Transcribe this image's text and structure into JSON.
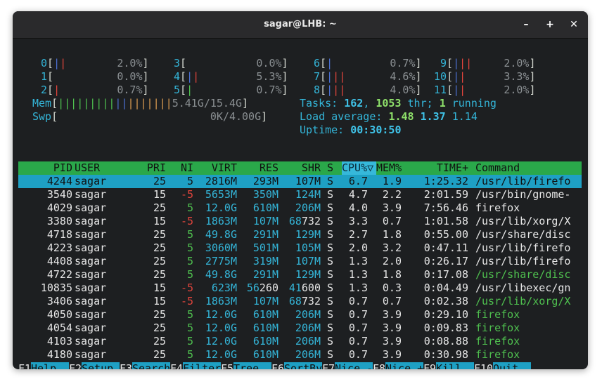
{
  "window": {
    "title": "sagar@LHB: ~",
    "minimize": "–",
    "maximize": "+",
    "close": "✕"
  },
  "cpus": [
    {
      "id": "0",
      "value": "2.0%"
    },
    {
      "id": "1",
      "value": "0.0%"
    },
    {
      "id": "2",
      "value": "0.7%"
    },
    {
      "id": "3",
      "value": "0.0%"
    },
    {
      "id": "4",
      "value": "5.3%"
    },
    {
      "id": "5",
      "value": "0.7%"
    },
    {
      "id": "6",
      "value": "0.7%"
    },
    {
      "id": "7",
      "value": "4.6%"
    },
    {
      "id": "8",
      "value": "4.0%"
    },
    {
      "id": "9",
      "value": "2.0%"
    },
    {
      "id": "10",
      "value": "3.3%"
    },
    {
      "id": "11",
      "value": "2.0%"
    }
  ],
  "mem": {
    "label": "Mem",
    "value": "5.41G/15.4G"
  },
  "swp": {
    "label": "Swp",
    "value": "0K/4.00G"
  },
  "tasks": {
    "label": "Tasks: ",
    "count": "162",
    "thr": "1053",
    "thr_label": " thr; ",
    "running": "1",
    "running_label": " running"
  },
  "load": {
    "label": "Load average: ",
    "v1": "1.48",
    "v2": "1.37",
    "v3": "1.14"
  },
  "uptime": {
    "label": "Uptime: ",
    "value": "00:30:50"
  },
  "columns": [
    "PID",
    "USER",
    "PRI",
    "NI",
    "VIRT",
    "RES",
    "SHR",
    "S",
    "CPU%▽",
    "MEM%",
    "TIME+",
    "Command"
  ],
  "processes": [
    {
      "pid": "4244",
      "user": "sagar",
      "pri": "25",
      "ni": "5",
      "virt": "2816M",
      "res": "293M",
      "shr": "107M",
      "s": "S",
      "cpu": "6.7",
      "mem": "1.9",
      "time": "1:25.32",
      "cmd": "/usr/lib/firefo"
    },
    {
      "pid": "3540",
      "user": "sagar",
      "pri": "15",
      "ni": "-5",
      "virt": "5653M",
      "res": "350M",
      "shr": "124M",
      "s": "S",
      "cpu": "4.7",
      "mem": "2.2",
      "time": "2:01.59",
      "cmd": "/usr/bin/gnome-"
    },
    {
      "pid": "4029",
      "user": "sagar",
      "pri": "25",
      "ni": "5",
      "virt": "12.0G",
      "res": "610M",
      "shr": "206M",
      "s": "S",
      "cpu": "4.0",
      "mem": "3.9",
      "time": "7:56.46",
      "cmd": "firefox"
    },
    {
      "pid": "3380",
      "user": "sagar",
      "pri": "15",
      "ni": "-5",
      "virt": "1863M",
      "res": "107M",
      "shr": "68732",
      "s": "S",
      "cpu": "3.3",
      "mem": "0.7",
      "time": "1:01.58",
      "cmd": "/usr/lib/xorg/X"
    },
    {
      "pid": "4718",
      "user": "sagar",
      "pri": "25",
      "ni": "5",
      "virt": "49.8G",
      "res": "291M",
      "shr": "129M",
      "s": "S",
      "cpu": "2.7",
      "mem": "1.8",
      "time": "0:55.00",
      "cmd": "/usr/share/disc"
    },
    {
      "pid": "4223",
      "user": "sagar",
      "pri": "25",
      "ni": "5",
      "virt": "3060M",
      "res": "501M",
      "shr": "105M",
      "s": "S",
      "cpu": "2.0",
      "mem": "3.2",
      "time": "0:47.11",
      "cmd": "/usr/lib/firefo"
    },
    {
      "pid": "4408",
      "user": "sagar",
      "pri": "25",
      "ni": "5",
      "virt": "2775M",
      "res": "319M",
      "shr": "107M",
      "s": "S",
      "cpu": "1.3",
      "mem": "2.0",
      "time": "0:26.17",
      "cmd": "/usr/lib/firefo"
    },
    {
      "pid": "4722",
      "user": "sagar",
      "pri": "25",
      "ni": "5",
      "virt": "49.8G",
      "res": "291M",
      "shr": "129M",
      "s": "S",
      "cpu": "1.3",
      "mem": "1.8",
      "time": "0:17.08",
      "cmd": "/usr/share/disc"
    },
    {
      "pid": "10835",
      "user": "sagar",
      "pri": "15",
      "ni": "-5",
      "virt": "623M",
      "res": "56260",
      "shr": "41600",
      "s": "S",
      "cpu": "1.3",
      "mem": "0.3",
      "time": "0:04.49",
      "cmd": "/usr/libexec/gn"
    },
    {
      "pid": "3406",
      "user": "sagar",
      "pri": "15",
      "ni": "-5",
      "virt": "1863M",
      "res": "107M",
      "shr": "68732",
      "s": "S",
      "cpu": "0.7",
      "mem": "0.7",
      "time": "0:02.38",
      "cmd": "/usr/lib/xorg/X"
    },
    {
      "pid": "4050",
      "user": "sagar",
      "pri": "25",
      "ni": "5",
      "virt": "12.0G",
      "res": "610M",
      "shr": "206M",
      "s": "S",
      "cpu": "0.7",
      "mem": "3.9",
      "time": "0:29.10",
      "cmd": "firefox"
    },
    {
      "pid": "4054",
      "user": "sagar",
      "pri": "25",
      "ni": "5",
      "virt": "12.0G",
      "res": "610M",
      "shr": "206M",
      "s": "S",
      "cpu": "0.7",
      "mem": "3.9",
      "time": "0:09.83",
      "cmd": "firefox"
    },
    {
      "pid": "4103",
      "user": "sagar",
      "pri": "25",
      "ni": "5",
      "virt": "12.0G",
      "res": "610M",
      "shr": "206M",
      "s": "S",
      "cpu": "0.7",
      "mem": "3.9",
      "time": "0:08.88",
      "cmd": "firefox"
    },
    {
      "pid": "4180",
      "user": "sagar",
      "pri": "25",
      "ni": "5",
      "virt": "12.0G",
      "res": "610M",
      "shr": "206M",
      "s": "S",
      "cpu": "0.7",
      "mem": "3.9",
      "time": "0:30.98",
      "cmd": "firefox"
    }
  ],
  "fkeys": [
    {
      "key": "F1",
      "label": "Help  "
    },
    {
      "key": "F2",
      "label": "Setup "
    },
    {
      "key": "F3",
      "label": "Search"
    },
    {
      "key": "F4",
      "label": "Filter"
    },
    {
      "key": "F5",
      "label": "Tree  "
    },
    {
      "key": "F6",
      "label": "SortBy"
    },
    {
      "key": "F7",
      "label": "Nice -"
    },
    {
      "key": "F8",
      "label": "Nice +"
    },
    {
      "key": "F9",
      "label": "Kill  "
    },
    {
      "key": "F10",
      "label": "Quit  "
    }
  ],
  "colors": {
    "header_bg": "#2aa84a",
    "selected_bg": "#1ea0c4",
    "fkey_label_bg": "#1ea0c4"
  }
}
